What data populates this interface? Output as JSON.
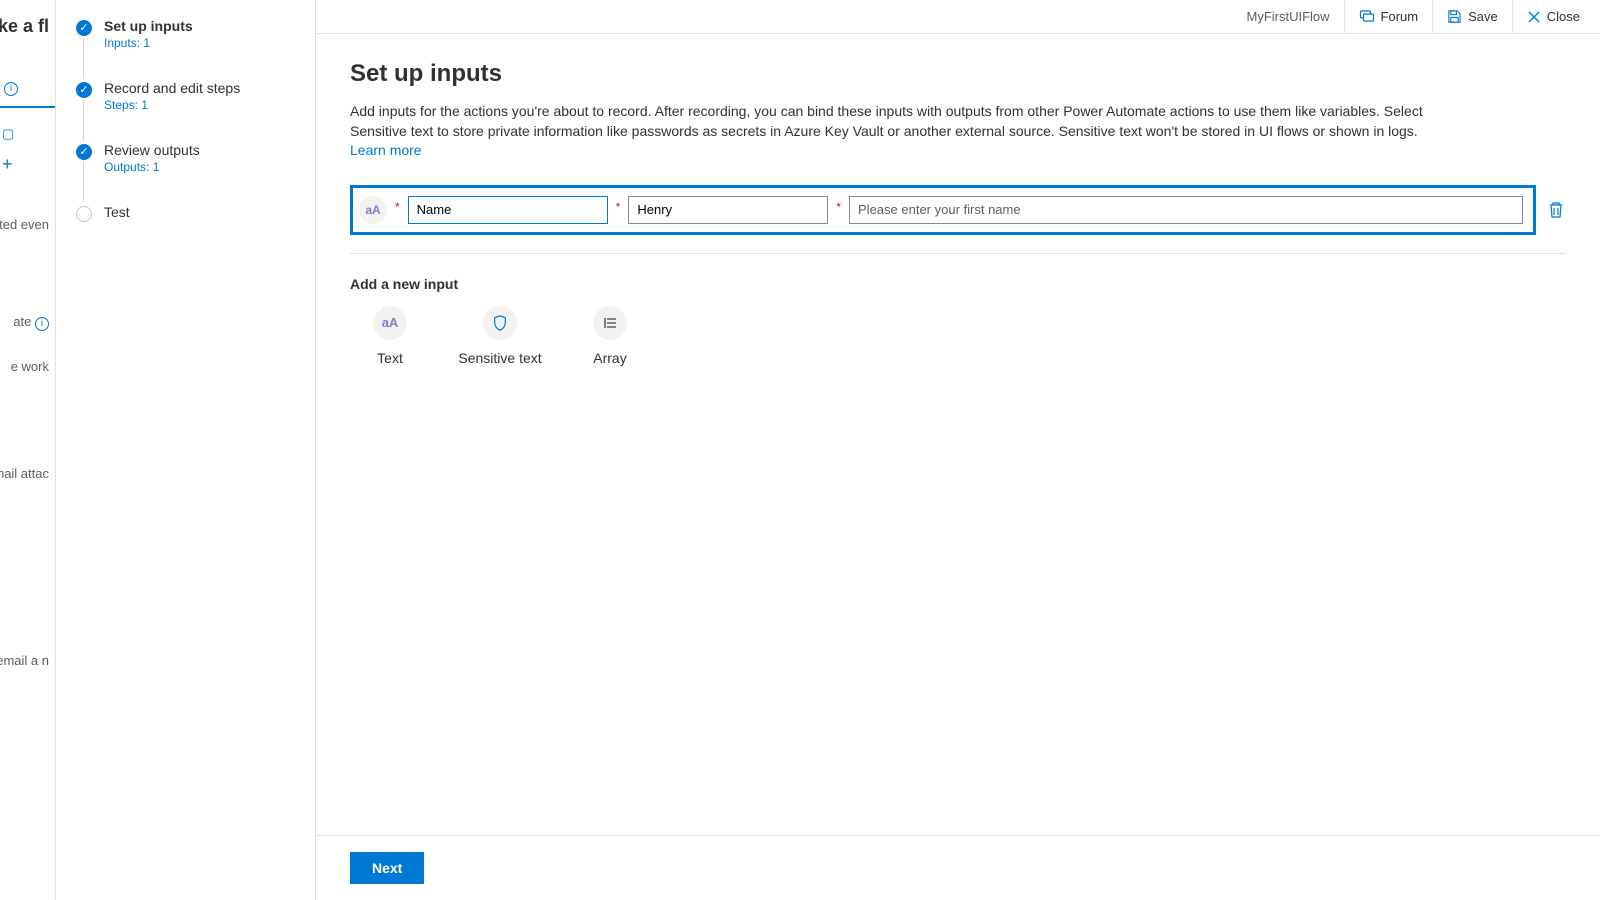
{
  "far_left": {
    "title_frag": "ake a fl",
    "info_icon": "i",
    "plus_icon": "+",
    "tab1": "nated even",
    "tab2_label": "ate",
    "tab2_sub": "e work",
    "item_a": "mail attac",
    "item_b": "email a n"
  },
  "stepper": [
    {
      "title": "Set up inputs",
      "sub": "Inputs: 1",
      "done": true,
      "active": true
    },
    {
      "title": "Record and edit steps",
      "sub": "Steps: 1",
      "done": true,
      "active": false
    },
    {
      "title": "Review outputs",
      "sub": "Outputs: 1",
      "done": true,
      "active": false
    },
    {
      "title": "Test",
      "sub": "",
      "done": false,
      "active": false
    }
  ],
  "topbar": {
    "flow_name": "MyFirstUIFlow",
    "forum": "Forum",
    "save": "Save",
    "close": "Close"
  },
  "page": {
    "title": "Set up inputs",
    "description": "Add inputs for the actions you're about to record. After recording, you can bind these inputs with outputs from other Power Automate actions to use them like variables. Select Sensitive text to store private information like passwords as secrets in Azure Key Vault or another external source. Sensitive text won't be stored in UI flows or shown in logs. ",
    "learn_more": "Learn more"
  },
  "input_row": {
    "type_badge": "aA",
    "name_value": "Name",
    "sample_value": "Henry",
    "description_value": "Please enter your first name"
  },
  "add": {
    "heading": "Add a new input",
    "options": [
      {
        "key": "text",
        "label": "Text",
        "glyph": "aA"
      },
      {
        "key": "sensitive",
        "label": "Sensitive text",
        "glyph": "shield"
      },
      {
        "key": "array",
        "label": "Array",
        "glyph": "list"
      }
    ]
  },
  "footer": {
    "next": "Next"
  },
  "colors": {
    "accent": "#0078d4"
  }
}
